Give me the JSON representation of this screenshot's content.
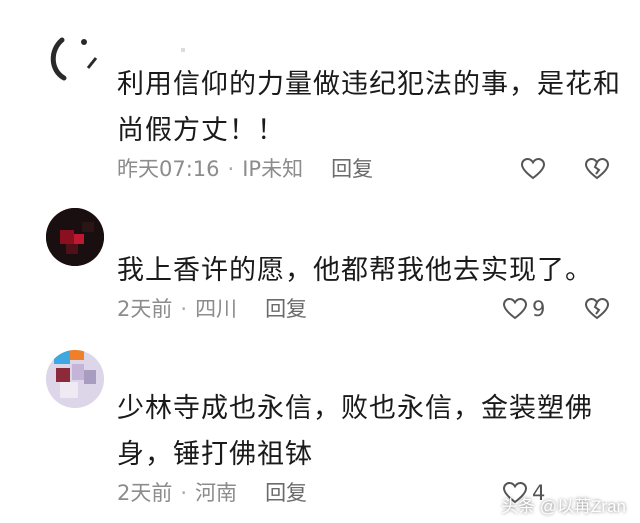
{
  "comments": [
    {
      "text": "利用信仰的力量做违纪犯法的事，是花和\n尚假方丈！！",
      "time": "昨天07:16",
      "location": "IP未知",
      "reply_label": "回复",
      "like_count": ""
    },
    {
      "text": "我上香许的愿，他都帮我他去实现了。",
      "time": "2天前",
      "location": "四川",
      "reply_label": "回复",
      "like_count": "9"
    },
    {
      "text": "少林寺成也永信，败也永信，金装塑佛\n身，锤打佛祖钵",
      "time": "2天前",
      "location": "河南",
      "reply_label": "回复",
      "like_count": "4"
    }
  ],
  "separator": "·",
  "watermark": "头条 @以苒Zran",
  "colors": {
    "meta": "#8c8c8c",
    "text": "#1a1a1a",
    "icon": "#555555"
  }
}
